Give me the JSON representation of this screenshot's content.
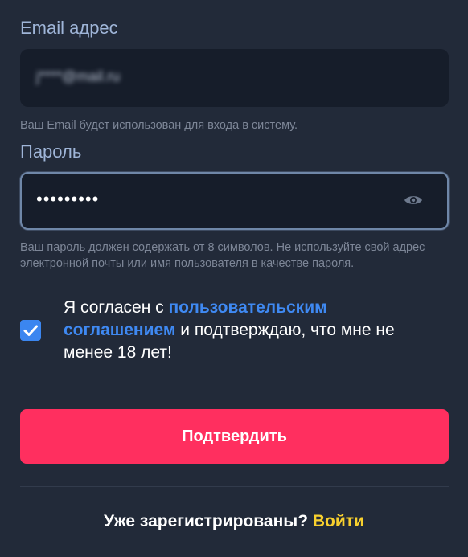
{
  "email": {
    "label": "Email адрес",
    "value_blurred": "j****@mail.ru",
    "hint": "Ваш Email будет использован для входа в систему."
  },
  "password": {
    "label": "Пароль",
    "value_masked": "•••••••••",
    "hint": "Ваш пароль должен содержать от 8 символов. Не используйте свой адрес электронной почты или имя пользователя в качестве пароля.",
    "toggle_icon": "eye-icon"
  },
  "agreement": {
    "checked": true,
    "text_before": "Я согласен с ",
    "link_text": "пользовательским соглашением",
    "text_after": " и подтверждаю, что мне не менее 18 лет!"
  },
  "submit": {
    "label": "Подтвердить"
  },
  "footer": {
    "question": "Уже зарегистрированы? ",
    "login_link": "Войти"
  },
  "colors": {
    "background": "#222a39",
    "field": "#161d2a",
    "label": "#9fb5d8",
    "accent_blue": "#3b86f0",
    "submit": "#ff2f5f",
    "link_yellow": "#f8d02e"
  }
}
